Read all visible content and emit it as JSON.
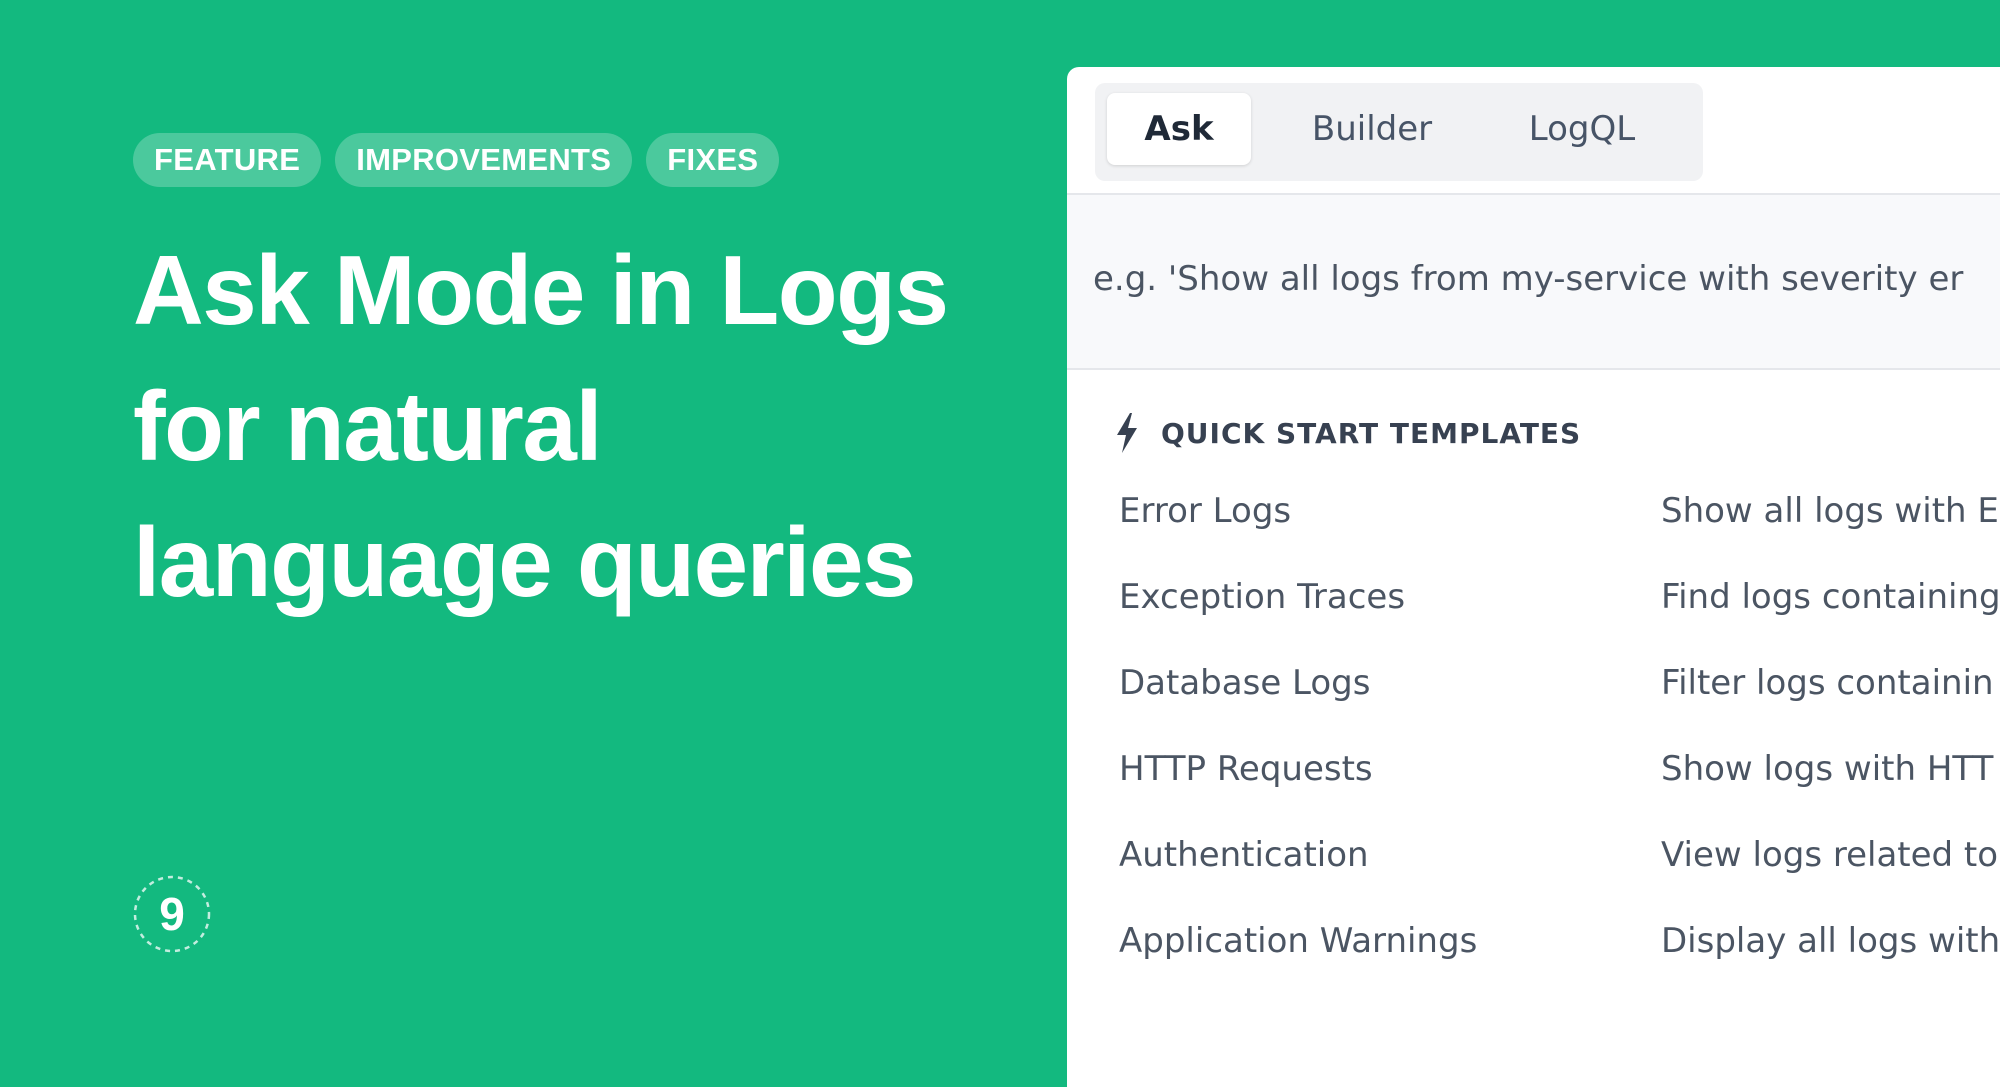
{
  "tags": [
    "FEATURE",
    "IMPROVEMENTS",
    "FIXES"
  ],
  "headline": {
    "line1": "Ask Mode in Logs",
    "line2": "for natural",
    "line3": "language queries"
  },
  "logo": {
    "text": "9",
    "icon": "signoz-logo-icon"
  },
  "app": {
    "tabs": [
      {
        "label": "Ask",
        "active": true
      },
      {
        "label": "Builder",
        "active": false
      },
      {
        "label": "LogQL",
        "active": false
      }
    ],
    "query": {
      "placeholder": "e.g. 'Show all logs from my-service with severity er"
    },
    "templates": {
      "title": "QUICK START TEMPLATES",
      "icon": "bolt-icon",
      "items": [
        {
          "name": "Error Logs",
          "description": "Show all logs with E"
        },
        {
          "name": "Exception Traces",
          "description": "Find logs containing"
        },
        {
          "name": "Database Logs",
          "description": "Filter logs containin"
        },
        {
          "name": "HTTP Requests",
          "description": "Show logs with HTT"
        },
        {
          "name": "Authentication",
          "description": "View logs related to"
        },
        {
          "name": "Application Warnings",
          "description": "Display all logs with"
        }
      ]
    }
  },
  "colors": {
    "background": "#13b97f",
    "panel": "#ffffff",
    "text": "#4b5563"
  }
}
